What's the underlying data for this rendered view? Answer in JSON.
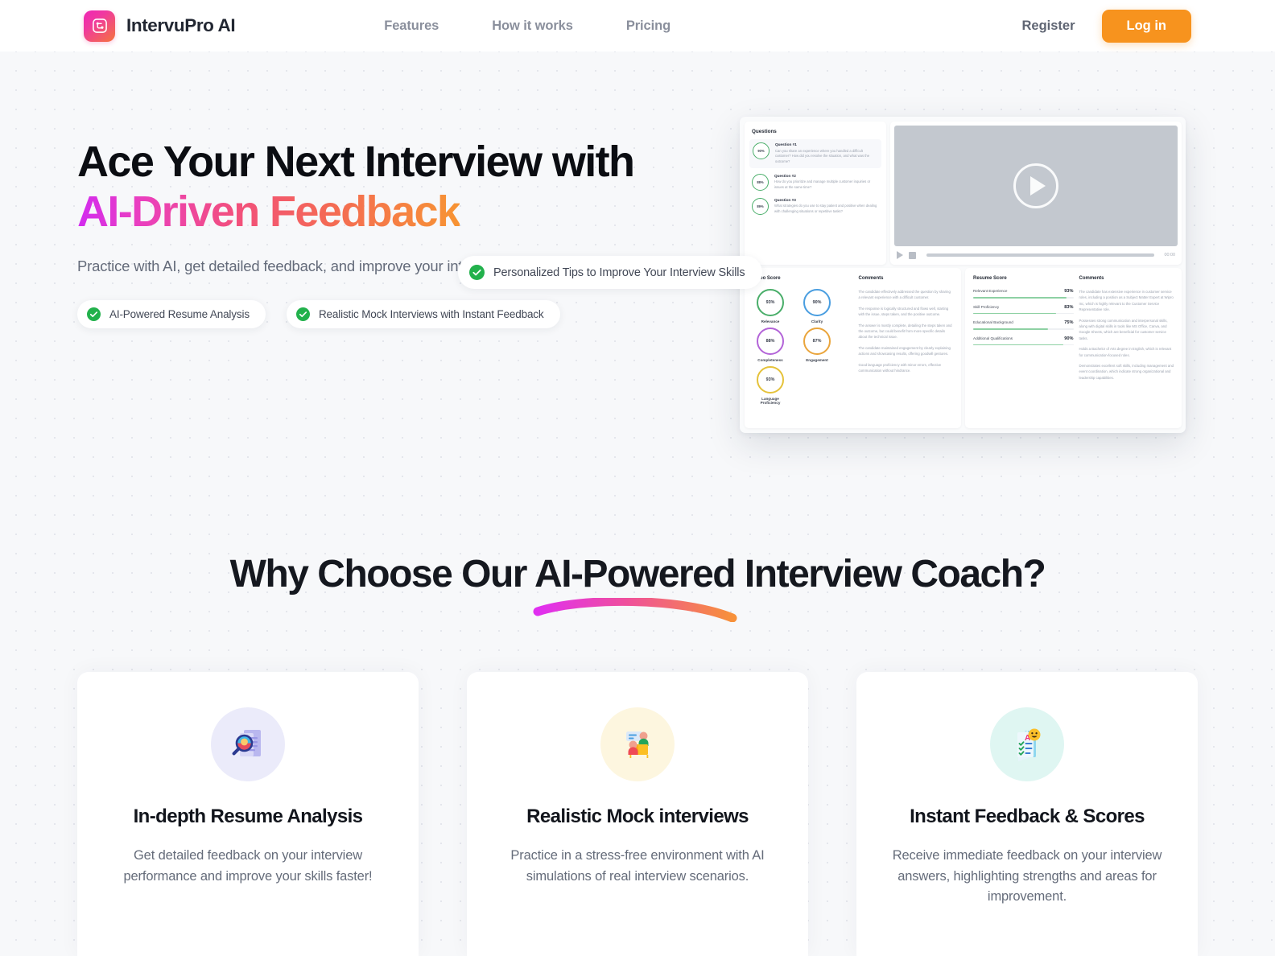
{
  "brand": {
    "name": "IntervuPro AI",
    "logo_icon": "app-logo-icon"
  },
  "nav": {
    "items": [
      {
        "label": "Features"
      },
      {
        "label": "How it works"
      },
      {
        "label": "Pricing"
      }
    ]
  },
  "auth": {
    "register_label": "Register",
    "login_label": "Log in",
    "login_bg": "#f7931e"
  },
  "hero": {
    "title_line1": "Ace Your Next Interview with",
    "title_line2": "AI-Driven Feedback",
    "gradient_from": "#d22bf0",
    "gradient_to": "#f79433",
    "subtitle": "Practice with AI, get detailed feedback, and improve your interview skills faster!",
    "badges": [
      {
        "label": "AI-Powered Resume Analysis",
        "icon": "check-circle-icon"
      },
      {
        "label": "Realistic Mock Interviews with Instant Feedback",
        "icon": "check-circle-icon"
      },
      {
        "label": "Personalized Tips to Improve Your Interview Skills",
        "icon": "check-circle-icon"
      }
    ]
  },
  "mock": {
    "questions": {
      "title": "Questions",
      "items": [
        {
          "score": "90%",
          "head": "Question #1",
          "body": "Can you share an experience where you handled a difficult customer? How did you resolve the situation, and what was the outcome?"
        },
        {
          "score": "88%",
          "head": "Question #2",
          "body": "How do you prioritize and manage multiple customer inquiries or issues at the same time?"
        },
        {
          "score": "89%",
          "head": "Question #3",
          "body": "What strategies do you use to stay patient and positive when dealing with challenging situations or repetitive tasks?"
        }
      ]
    },
    "video": {
      "time": "00:00",
      "play_icon": "play-icon",
      "stop_icon": "stop-icon"
    },
    "video_score": {
      "title": "Video Score",
      "comments_title": "Comments",
      "rings": [
        {
          "label": "Relevance",
          "value": "93%",
          "color": "#4aae6a"
        },
        {
          "label": "Clarity",
          "value": "90%",
          "color": "#4a9ee0"
        },
        {
          "label": "Completeness",
          "value": "88%",
          "color": "#b364d8"
        },
        {
          "label": "Engagement",
          "value": "87%",
          "color": "#eaa53c"
        },
        {
          "label": "Language Proficiency",
          "value": "93%",
          "color": "#e5c23a"
        }
      ],
      "comments": [
        "The candidate effectively addressed the question by sharing a relevant experience with a difficult customer.",
        "The response is logically structured and flows well, starting with the issue, steps taken, and the positive outcome.",
        "The answer is mostly complete, detailing the steps taken and the outcome, but could benefit from more specific details about the technical issue.",
        "The candidate maintained engagement by clearly explaining actions and showcasing results, offering goodwill gestures.",
        "Good language proficiency with minor errors, effective communication without hindrance."
      ]
    },
    "resume_score": {
      "title": "Resume Score",
      "comments_title": "Comments",
      "bars": [
        {
          "label": "Relevant Experience",
          "value": "93%",
          "pct": 93
        },
        {
          "label": "Skill Proficiency",
          "value": "83%",
          "pct": 83
        },
        {
          "label": "Educational Background",
          "value": "75%",
          "pct": 75
        },
        {
          "label": "Additional Qualifications",
          "value": "90%",
          "pct": 90
        }
      ],
      "comments": [
        "The candidate has extensive experience in customer service roles, including a position as a Subject Matter Expert at Wipro Inc, which is highly relevant to the Customer Service Representative role.",
        "Possesses strong communication and interpersonal skills, along with digital skills in tools like MS Office, Canva, and Google Sheets, which are beneficial for customer service tasks.",
        "Holds a Bachelor of Arts degree in English, which is relevant for communication-focused roles.",
        "Demonstrates excellent soft skills, including management and event coordination, which indicate strong organizational and leadership capabilities."
      ]
    }
  },
  "why": {
    "heading": "Why Choose Our AI-Powered Interview Coach?",
    "cards": [
      {
        "icon": "resume-magnifier-icon",
        "title": "In-depth Resume Analysis",
        "body": "Get detailed feedback on your interview performance and improve your skills faster!"
      },
      {
        "icon": "mock-interview-people-icon",
        "title": "Realistic Mock interviews",
        "body": "Practice in a stress-free environment with AI simulations of real interview scenarios."
      },
      {
        "icon": "report-card-smiley-icon",
        "title": "Instant Feedback & Scores",
        "body": "Receive immediate feedback on your interview answers, highlighting strengths and areas for improvement."
      }
    ]
  }
}
